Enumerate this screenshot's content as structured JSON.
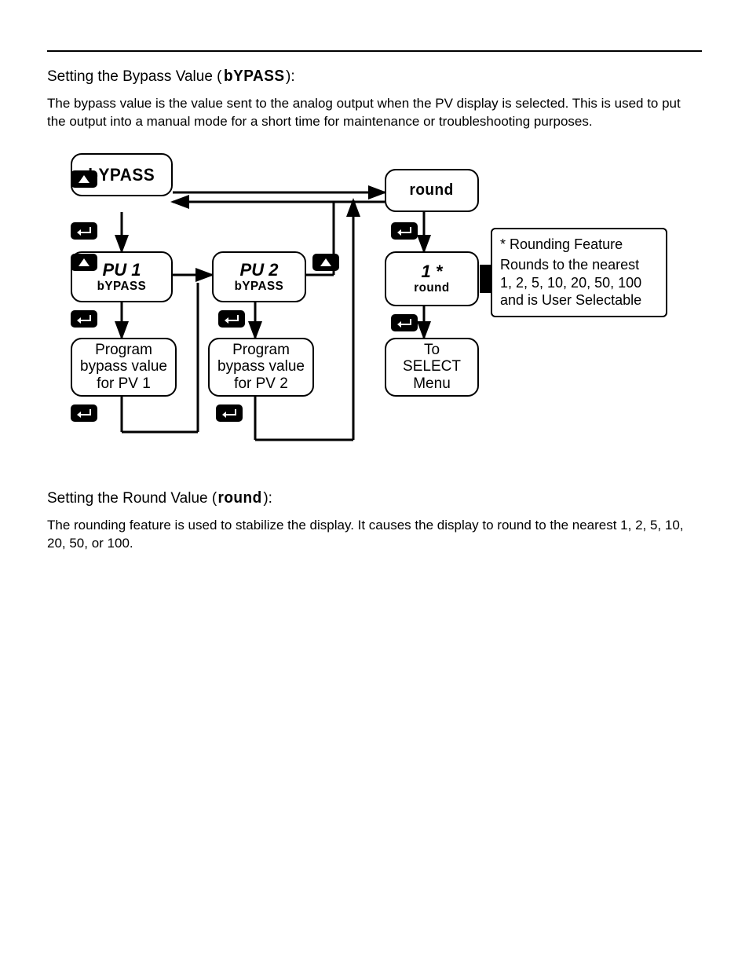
{
  "intro": {
    "title_prefix": "Setting the Bypass Value (",
    "title_seg": "bYPASS",
    "title_suffix": "):",
    "para": "The bypass value is the value sent to the analog output when the PV display is selected. This is used to put the output into a manual mode for a short time for maintenance or troubleshooting purposes."
  },
  "nodes": {
    "bypass": "bYPASS",
    "pv1_top": "PU  1",
    "pv1_sub": "bYPASS",
    "pv2_top": "PU  2",
    "pv2_sub": "bYPASS",
    "prog1_l1": "Program",
    "prog1_l2": "bypass value",
    "prog1_l3": "for PV 1",
    "prog2_l1": "Program",
    "prog2_l2": "bypass value",
    "prog2_l3": "for PV 2",
    "round": "round",
    "one_star": "1  *",
    "one_star_sub": "round",
    "tosel_l1": "To",
    "tosel_l2": "SELECT",
    "tosel_l3": "Menu"
  },
  "callout": {
    "l1": "* Rounding Feature",
    "l2": "Rounds to the nearest",
    "l3": "1, 2, 5, 10, 20, 50, 100",
    "l4": "and is User Selectable"
  },
  "round_sec": {
    "title_prefix": "Setting the Round Value (",
    "title_seg": "round",
    "title_suffix": "):",
    "para": "The rounding feature is used to stabilize the display. It causes the display to round to the nearest 1, 2, 5, 10, 20, 50, or 100."
  },
  "icons": {
    "up": "up-arrow-icon",
    "enter": "enter-icon"
  }
}
